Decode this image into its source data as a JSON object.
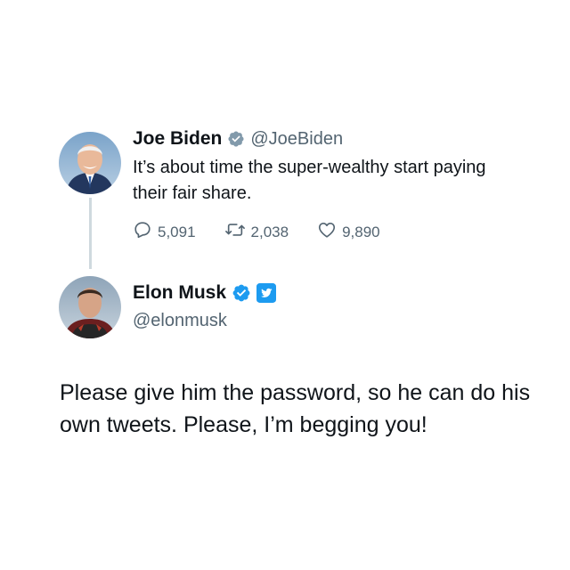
{
  "original_tweet": {
    "display_name": "Joe Biden",
    "handle": "@JoeBiden",
    "text": "It’s about time the super-wealthy start paying their fair share.",
    "stats": {
      "replies": "5,091",
      "retweets": "2,038",
      "likes": "9,890"
    },
    "icons": [
      "verified-icon",
      "reply-icon",
      "retweet-icon",
      "like-icon"
    ]
  },
  "reply_tweet": {
    "display_name": "Elon Musk",
    "handle": "@elonmusk",
    "text": "Please give him the password, so he can do his own tweets. Please, I’m begging you!",
    "icons": [
      "verified-icon",
      "twitter-logo-icon"
    ]
  },
  "colors": {
    "verified_blue": "#1d9bf0",
    "text_primary": "#0f1419",
    "text_secondary": "#536471",
    "thread_line": "#cfd9de"
  }
}
